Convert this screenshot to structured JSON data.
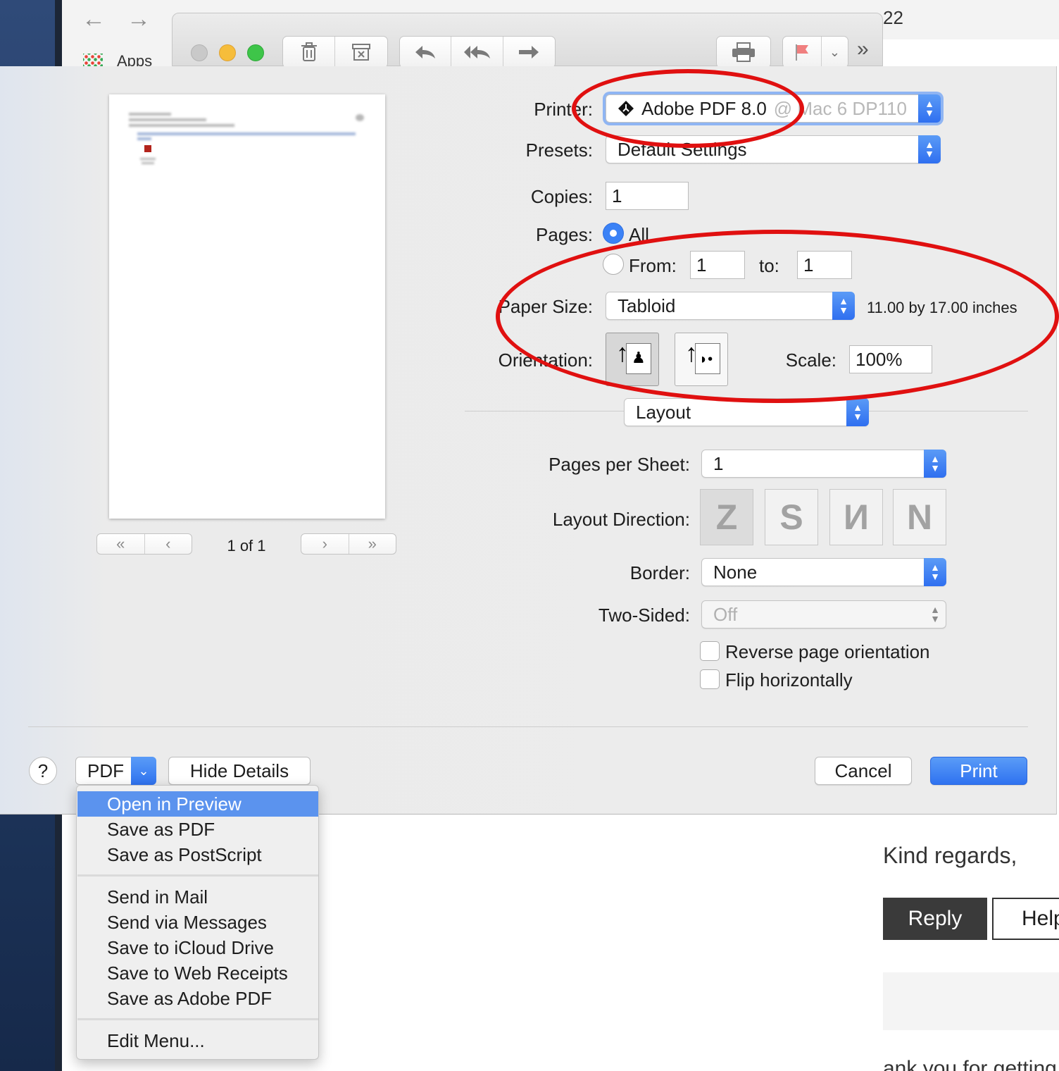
{
  "browser": {
    "back_glyph": "←",
    "forward_glyph": "→",
    "apps_label": "Apps",
    "url_fragment": "22"
  },
  "mail_toolbar": {
    "delete_icon": "trash-icon",
    "junk_icon": "junk-icon",
    "reply_icon": "reply-icon",
    "reply_all_icon": "reply-all-icon",
    "forward_icon": "forward-icon",
    "print_icon": "printer-icon",
    "flag_icon": "flag-icon",
    "flag_color": "#f07f7f",
    "more_label": "»"
  },
  "print": {
    "preview_page": {
      "current": 1,
      "total": 1,
      "label": "1 of 1"
    },
    "printer_label": "Printer:",
    "printer_value": "Adobe PDF 8.0",
    "printer_suffix": "@ Mac 6 DP110",
    "presets_label": "Presets:",
    "presets_value": "Default Settings",
    "copies_label": "Copies:",
    "copies_value": "1",
    "pages_label": "Pages:",
    "pages_all_label": "All",
    "pages_from_label": "From:",
    "pages_from_value": "1",
    "pages_to_label": "to:",
    "pages_to_value": "1",
    "paper_size_label": "Paper Size:",
    "paper_size_value": "Tabloid",
    "paper_size_dims": "11.00 by 17.00 inches",
    "orientation_label": "Orientation:",
    "scale_label": "Scale:",
    "scale_value": "100%",
    "section_value": "Layout",
    "pages_per_sheet_label": "Pages per Sheet:",
    "pages_per_sheet_value": "1",
    "layout_direction_label": "Layout Direction:",
    "border_label": "Border:",
    "border_value": "None",
    "two_sided_label": "Two-Sided:",
    "two_sided_value": "Off",
    "reverse_label": "Reverse page orientation",
    "flip_label": "Flip horizontally",
    "help_label": "?",
    "pdf_label": "PDF",
    "hide_details_label": "Hide Details",
    "cancel_label": "Cancel",
    "print_label": "Print",
    "accent_color": "#3b82f6"
  },
  "pdf_menu": {
    "items": [
      "Open in Preview",
      "Save as PDF",
      "Save as PostScript",
      "Send in Mail",
      "Send via Messages",
      "Save to iCloud Drive",
      "Save to Web Receipts",
      "Save as Adobe PDF",
      "Edit Menu..."
    ],
    "highlighted": "Open in Preview"
  },
  "mail": {
    "kind_regards": "Kind regards,",
    "reply_label": "Reply",
    "help_label": "Help",
    "bottom_fragment": "ank you for getting"
  },
  "annotation_color": "#e01010"
}
